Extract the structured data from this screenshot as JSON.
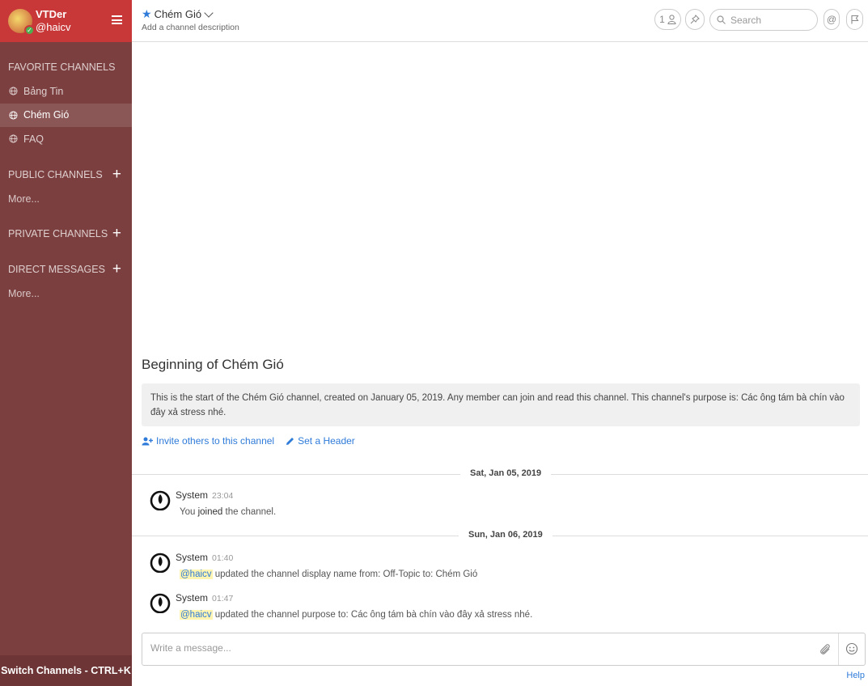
{
  "user": {
    "display_name": "VTDer",
    "handle": "@haicv"
  },
  "sidebar": {
    "favorites_title": "FAVORITE CHANNELS",
    "favorites": [
      {
        "label": "Bảng Tin",
        "active": false
      },
      {
        "label": "Chém Gió",
        "active": true
      },
      {
        "label": "FAQ",
        "active": false
      }
    ],
    "public_title": "PUBLIC CHANNELS",
    "public_more": "More...",
    "private_title": "PRIVATE CHANNELS",
    "direct_title": "DIRECT MESSAGES",
    "direct_more": "More...",
    "switch_label": "Switch Channels - CTRL+K"
  },
  "header": {
    "channel_name": "Chém Gió",
    "channel_description": "Add a channel description",
    "member_count": "1",
    "search_placeholder": "Search"
  },
  "intro": {
    "title": "Beginning of Chém Gió",
    "text": "This is the start of the Chém Gió channel, created on January 05, 2019. Any member can join and read this channel. This channel's purpose is: Các ông tám bà chín vào đây xả stress nhé.",
    "invite_label": "Invite others to this channel",
    "header_label": "Set a Header"
  },
  "dates": [
    "Sat, Jan 05, 2019",
    "Sun, Jan 06, 2019"
  ],
  "messages": [
    {
      "author": "System",
      "time": "23:04",
      "text_pre": "You ",
      "text_bold": "joined",
      "text_post": " the channel."
    },
    {
      "author": "System",
      "time": "01:40",
      "mention": "@haicv",
      "text": " updated the channel display name from: Off-Topic to: Chém Gió"
    },
    {
      "author": "System",
      "time": "01:47",
      "mention": "@haicv",
      "text": " updated the channel purpose to: Các ông tám bà chín vào đây xả stress nhé."
    }
  ],
  "composer": {
    "placeholder": "Write a message...",
    "help": "Help"
  },
  "colors": {
    "sidebar_bg": "#7c3f3f",
    "sidebar_header": "#c93838",
    "link": "#2f7bd9",
    "mention_bg": "#fff5b1"
  }
}
